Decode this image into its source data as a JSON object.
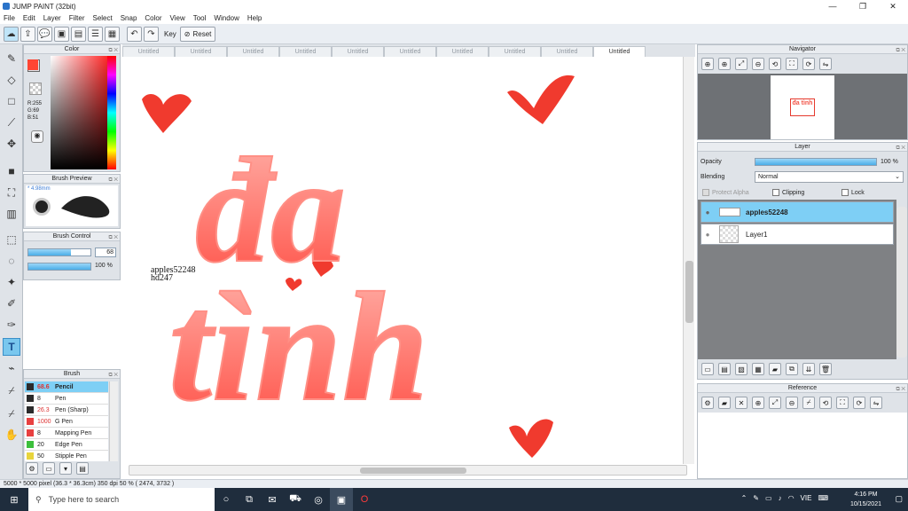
{
  "window": {
    "title": "JUMP PAINT (32bit)",
    "controls": [
      "—",
      "❐",
      "✕"
    ]
  },
  "menu": [
    "File",
    "Edit",
    "Layer",
    "Filter",
    "Select",
    "Snap",
    "Color",
    "View",
    "Tool",
    "Window",
    "Help"
  ],
  "toolbar": {
    "key_label": "Key",
    "reset_label": "Reset"
  },
  "panels": {
    "color": {
      "title": "Color",
      "r": "R:255",
      "g": "G:69",
      "b": "B:51",
      "fg": "#ff4533"
    },
    "brush_preview": {
      "title": "Brush Preview",
      "size": "* 4.98mm"
    },
    "brush_control": {
      "title": "Brush Control",
      "size_value": "68",
      "opacity_value": "100 %",
      "size_fraction": 0.68,
      "opacity_fraction": 1.0
    },
    "brush": {
      "title": "Brush",
      "items": [
        {
          "size": "68.6",
          "name": "Pencil",
          "color": "#2b2b2b",
          "active": true
        },
        {
          "size": "8",
          "name": "Pen",
          "color": "#2b2b2b",
          "active": false
        },
        {
          "size": "26.3",
          "name": "Pen (Sharp)",
          "color": "#2b2b2b",
          "active": false
        },
        {
          "size": "1000",
          "name": "G Pen",
          "color": "#e84040",
          "active": false
        },
        {
          "size": "8",
          "name": "Mapping Pen",
          "color": "#e84040",
          "active": false
        },
        {
          "size": "20",
          "name": "Edge Pen",
          "color": "#3cbf3c",
          "active": false
        },
        {
          "size": "50",
          "name": "Stipple Pen",
          "color": "#e8d43c",
          "active": false
        }
      ]
    }
  },
  "tabs": [
    "Untitled",
    "Untitled",
    "Untitled",
    "Untitled",
    "Untitled",
    "Untitled",
    "Untitled",
    "Untitled",
    "Untitled",
    "Untitled"
  ],
  "canvas": {
    "line1": "đa",
    "line2": "tình",
    "signature1": "apples52248",
    "signature2": "hd247"
  },
  "navigator": {
    "title": "Navigator",
    "thumb_text": "đa tình"
  },
  "layer": {
    "title": "Layer",
    "opacity_label": "Opacity",
    "opacity_value": "100 %",
    "opacity_fraction": 1.0,
    "blending_label": "Blending",
    "blending_value": "Normal",
    "protect_alpha": "Protect Alpha",
    "clipping": "Clipping",
    "lock": "Lock",
    "layers": [
      {
        "name": "apples52248",
        "selected": true
      },
      {
        "name": "Layer1",
        "selected": false
      }
    ]
  },
  "reference": {
    "title": "Reference"
  },
  "status": {
    "text": "5000 * 5000 pixel  (36.3 * 36.3cm)  350 dpi  50 %  ( 2474, 3732 )"
  },
  "taskbar": {
    "search_placeholder": "Type here to search",
    "time": "4:16 PM",
    "date": "10/15/2021",
    "lang": "VIE"
  }
}
